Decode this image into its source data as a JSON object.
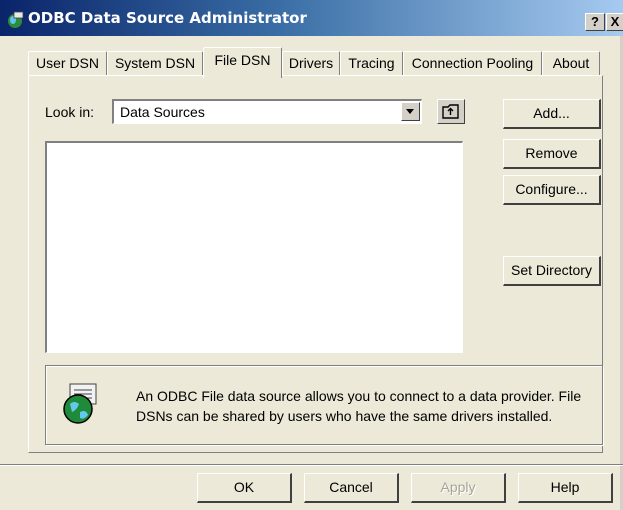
{
  "window": {
    "title": "ODBC Data Source Administrator",
    "help_button": "?",
    "close_button": "X"
  },
  "tabs": [
    {
      "label": "User DSN"
    },
    {
      "label": "System DSN"
    },
    {
      "label": "File DSN",
      "active": true
    },
    {
      "label": "Drivers"
    },
    {
      "label": "Tracing"
    },
    {
      "label": "Connection Pooling"
    },
    {
      "label": "About"
    }
  ],
  "file_dsn": {
    "look_in_label": "Look in:",
    "look_in_value": "Data Sources",
    "buttons": {
      "add": "Add...",
      "remove": "Remove",
      "configure": "Configure...",
      "set_directory": "Set Directory"
    },
    "info_text": "An ODBC File data source allows you to connect to a data provider.  File DSNs can be shared by users who have the same drivers installed."
  },
  "footer": {
    "ok": "OK",
    "cancel": "Cancel",
    "apply": "Apply",
    "help": "Help"
  }
}
